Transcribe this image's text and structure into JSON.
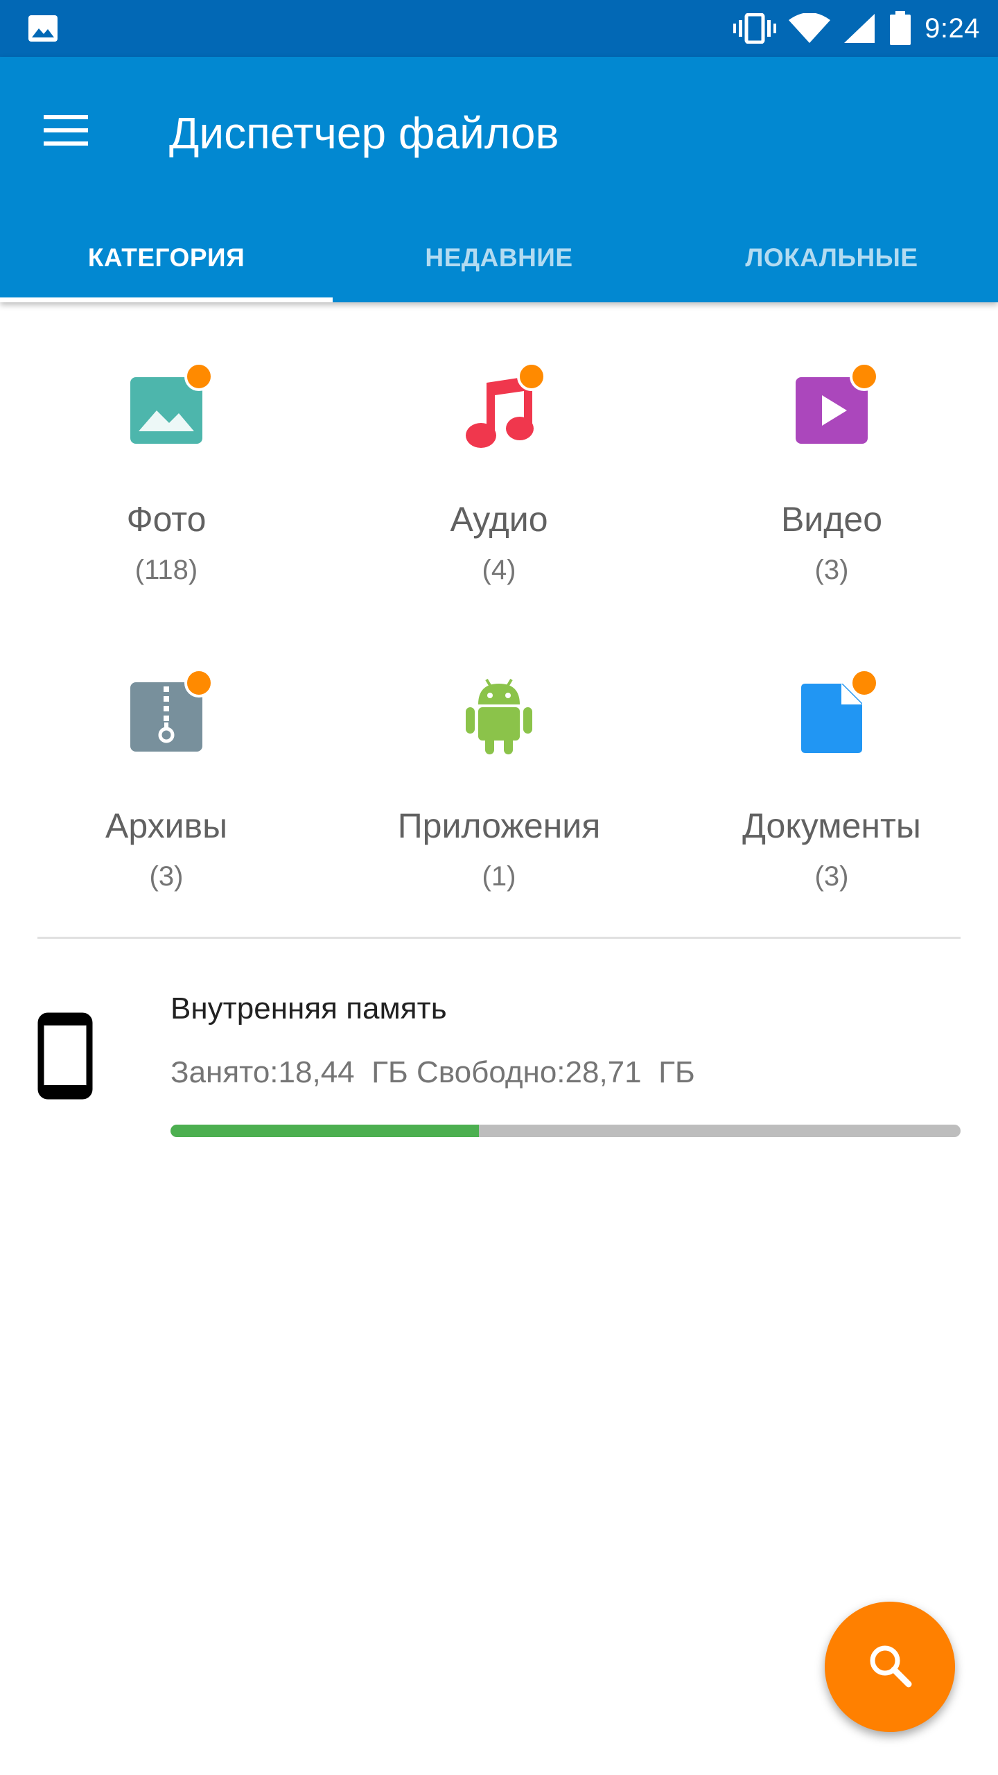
{
  "status_bar": {
    "time": "9:24",
    "icons": [
      "image-notification-icon",
      "vibrate-icon",
      "wifi-icon",
      "signal-icon",
      "battery-icon"
    ]
  },
  "app_bar": {
    "title": "Диспетчер файлов",
    "menu_icon": "hamburger-menu-icon",
    "background": "#0288d1"
  },
  "tabs": [
    {
      "label": "КАТЕГОРИЯ",
      "active": true
    },
    {
      "label": "НЕДАВНИЕ",
      "active": false
    },
    {
      "label": "ЛОКАЛЬНЫЕ",
      "active": false
    }
  ],
  "categories": [
    {
      "name": "Фото",
      "count": "(118)",
      "icon": "photo-icon",
      "color": "#4db6ac",
      "badge": true
    },
    {
      "name": "Аудио",
      "count": "(4)",
      "icon": "music-note-icon",
      "color": "#f0374d",
      "badge": true
    },
    {
      "name": "Видео",
      "count": "(3)",
      "icon": "video-play-icon",
      "color": "#ab47bc",
      "badge": true
    },
    {
      "name": "Архивы",
      "count": "(3)",
      "icon": "archive-zip-icon",
      "color": "#78909c",
      "badge": true
    },
    {
      "name": "Приложения",
      "count": "(1)",
      "icon": "android-icon",
      "color": "#8bc34a",
      "badge": false
    },
    {
      "name": "Документы",
      "count": "(3)",
      "icon": "document-icon",
      "color": "#2196f3",
      "badge": true
    }
  ],
  "badge_color": "#ff8a00",
  "storage": {
    "title": "Внутренняя память",
    "info": "Занято:18,44  ГБ Свободно:28,71  ГБ",
    "used_fraction": 0.39,
    "icon": "phone-icon",
    "used_color": "#4caf50",
    "track_color": "#bdbdbd"
  },
  "fab": {
    "icon": "search-icon",
    "color": "#ff8000"
  }
}
